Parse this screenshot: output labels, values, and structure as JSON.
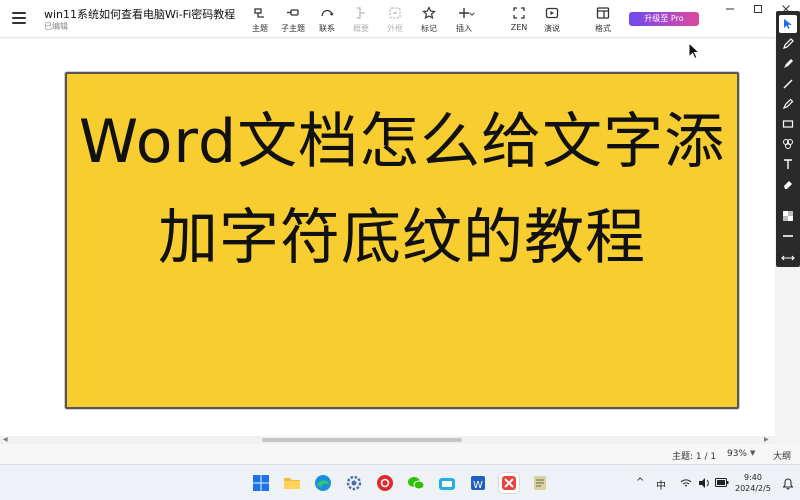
{
  "window": {
    "title": "win11系统如何查看电脑Wi-Fi密码教程",
    "status": "已编辑"
  },
  "toolbar": {
    "tools": [
      {
        "label": "主题",
        "icon": "topic-icon",
        "enabled": true
      },
      {
        "label": "子主题",
        "icon": "subtopic-icon",
        "enabled": true
      },
      {
        "label": "联系",
        "icon": "relationship-icon",
        "enabled": true
      },
      {
        "label": "概要",
        "icon": "summary-icon",
        "enabled": false
      },
      {
        "label": "外框",
        "icon": "boundary-icon",
        "enabled": false
      },
      {
        "label": "标记",
        "icon": "star-icon",
        "enabled": true
      },
      {
        "label": "插入",
        "icon": "plus-icon",
        "enabled": true
      },
      {
        "label": "ZEN",
        "icon": "zen-icon",
        "enabled": true
      },
      {
        "label": "演说",
        "icon": "play-icon",
        "enabled": true
      },
      {
        "label": "格式",
        "icon": "format-icon",
        "enabled": true
      }
    ],
    "upgrade_label": "升级至 Pro"
  },
  "slide": {
    "title": "Word文档怎么给文字添加字符底纹的教程",
    "background": "#f8cd2f"
  },
  "palette": {
    "tools": [
      "pointer-icon",
      "pencil-icon",
      "marker-icon",
      "line-icon",
      "highlighter-icon",
      "rectangle-icon",
      "color-icon",
      "text-icon",
      "eraser-icon",
      "pattern-icon",
      "stroke-icon",
      "resize-icon"
    ]
  },
  "statusbar": {
    "topic_count": "主题: 1 / 1",
    "zoom": "93%",
    "outline": "大纲"
  },
  "taskbar": {
    "apps": [
      "start-icon",
      "file-explorer-icon",
      "edge-icon",
      "settings-icon",
      "netease-music-icon",
      "wechat-icon",
      "bilibili-icon",
      "word-icon",
      "xmind-icon",
      "notepad-icon"
    ],
    "tray": {
      "expand": "^",
      "ime": "中",
      "time": "9:40",
      "date": "2024/2/5"
    }
  },
  "colors": {
    "accent": "#1a6fe8",
    "slide_fill": "#f8cd2f",
    "upgrade_from": "#6e4bf0",
    "upgrade_to": "#e0479f"
  }
}
